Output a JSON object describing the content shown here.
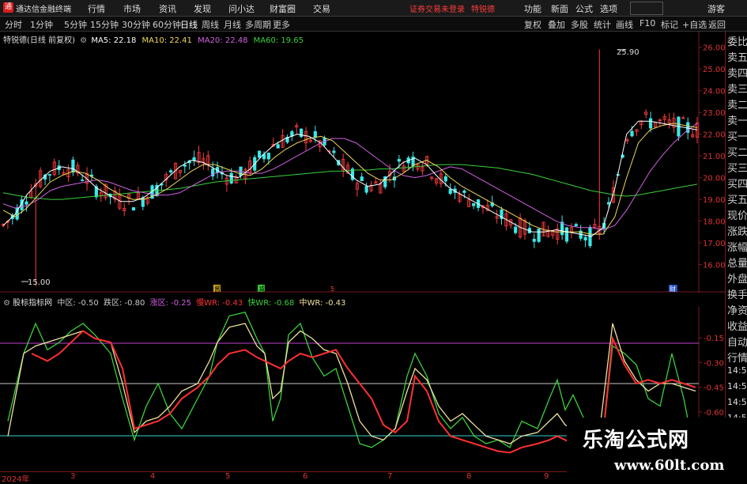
{
  "app": {
    "title": "通达信金融终端"
  },
  "menu": [
    "行情",
    "市场",
    "资讯",
    "发现",
    "问小达",
    "财富圈",
    "交易"
  ],
  "notice": {
    "text": "证券交易未登录",
    "stock": "特锐德"
  },
  "right_menu": [
    "功能",
    "新面",
    "公式",
    "选项"
  ],
  "guest": "游客",
  "periods": [
    "分时",
    "1分钟",
    "5分钟",
    "15分钟",
    "30分钟",
    "60分钟",
    "日线",
    "周线",
    "月线",
    "多周期",
    "更多"
  ],
  "active_period": "日线",
  "tools": [
    "复权",
    "叠加",
    "多股",
    "统计",
    "画线",
    "F10",
    "标记",
    "+自选",
    "返回"
  ],
  "stock": {
    "name": "特锐德(日线 前复权)"
  },
  "ma": [
    {
      "label": "MA5: 22.18",
      "color": "#ffffff"
    },
    {
      "label": "MA10: 22.41",
      "color": "#f0d85a"
    },
    {
      "label": "MA20: 22.48",
      "color": "#d060e0"
    },
    {
      "label": "MA60: 19.65",
      "color": "#3ad03a"
    }
  ],
  "price_axis": {
    "ticks": [
      "26.00",
      "25.00",
      "24.00",
      "23.00",
      "22.00",
      "21.00",
      "20.00",
      "19.00",
      "18.00",
      "17.00",
      "16.00"
    ],
    "range": [
      15.0,
      26.5
    ]
  },
  "annotations": {
    "high": "25.90",
    "low": "15.00",
    "marker_cai": "财",
    "marker_a": "酱",
    "marker_b": "减",
    "marker_c": "5"
  },
  "right_panel": [
    "委比",
    "卖五",
    "卖四",
    "卖三",
    "卖二",
    "卖一",
    "买一",
    "买二",
    "买三",
    "买四",
    "买五",
    "现价",
    "涨跌",
    "涨幅",
    "总量",
    "外盘",
    "换手",
    "净资",
    "收益",
    "自动",
    "行情",
    "14:5",
    "14:5",
    "14:5",
    "14:5",
    "14:5",
    "14:5"
  ],
  "indicator": {
    "name": "股标指标网",
    "items": [
      {
        "label": "中区: -0.50",
        "color": "#c8c8c8"
      },
      {
        "label": "跌区: -0.80",
        "color": "#c8c8c8"
      },
      {
        "label": "涨区: -0.25",
        "color": "#d060e0"
      },
      {
        "label": "慢WR: -0.43",
        "color": "#ff3030"
      },
      {
        "label": "快WR: -0.68",
        "color": "#3ad03a"
      },
      {
        "label": "中WR: -0.43",
        "color": "#f0e0a0"
      }
    ],
    "axis_ticks": [
      "-0.15",
      "-0.30",
      "-0.45",
      "-0.60"
    ],
    "range": [
      -0.9,
      0.0
    ]
  },
  "dates": [
    "2024年",
    "3",
    "4",
    "5",
    "6",
    "7",
    "8",
    "9"
  ],
  "colors": {
    "up": "#ff3c3c",
    "down": "#3ae8e8",
    "grid": "#7a1a1a",
    "ma60": "#3ad03a",
    "ma20": "#d060e0",
    "ma10": "#f0d85a",
    "ma5": "#ffffff"
  },
  "watermark": {
    "line1": "乐淘公式网",
    "line2": "www.60lt.com"
  },
  "chart_data": {
    "type": "candlestick",
    "ylim": [
      15.0,
      26.5
    ],
    "ma60": [
      19.3,
      19.2,
      19.1,
      19.05,
      19.0,
      19.0,
      19.05,
      19.1,
      19.15,
      19.2,
      19.25,
      19.3,
      19.35,
      19.4,
      19.45,
      19.5,
      19.6,
      19.7,
      19.8,
      19.85,
      19.9,
      19.95,
      20.0,
      20.05,
      20.1,
      20.15,
      20.2,
      20.25,
      20.3,
      20.3,
      20.35,
      20.35,
      20.4,
      20.4,
      20.45,
      20.5,
      20.55,
      20.6,
      20.6,
      20.6,
      20.55,
      20.5,
      20.45,
      20.35,
      20.25,
      20.15,
      20.0,
      19.85,
      19.7,
      19.55,
      19.4,
      19.3,
      19.2,
      19.15,
      19.2,
      19.3,
      19.4,
      19.5,
      19.6,
      19.7
    ],
    "ma20": [
      18.8,
      18.6,
      18.7,
      19.0,
      19.4,
      19.6,
      19.7,
      19.8,
      19.9,
      19.8,
      19.6,
      19.4,
      19.3,
      19.2,
      19.2,
      19.3,
      19.6,
      19.9,
      20.2,
      20.3,
      20.3,
      20.2,
      20.2,
      20.4,
      20.7,
      21.0,
      21.3,
      21.6,
      21.8,
      21.8,
      21.6,
      21.2,
      20.8,
      20.4,
      20.1,
      20.0,
      20.1,
      20.3,
      20.5,
      20.4,
      20.1,
      19.8,
      19.5,
      19.2,
      18.9,
      18.6,
      18.3,
      18.0,
      17.8,
      17.7,
      17.7,
      17.6,
      17.8,
      18.5,
      19.4,
      20.3,
      21.0,
      21.6,
      22.1,
      22.5
    ],
    "ma10": [
      18.5,
      18.2,
      18.6,
      19.2,
      19.8,
      20.1,
      20.3,
      20.2,
      19.9,
      19.5,
      19.2,
      19.0,
      19.0,
      19.2,
      19.5,
      19.9,
      20.3,
      20.6,
      20.6,
      20.4,
      20.2,
      20.1,
      20.4,
      20.9,
      21.3,
      21.6,
      21.8,
      21.9,
      21.7,
      21.2,
      20.7,
      20.2,
      19.9,
      19.9,
      20.2,
      20.6,
      20.8,
      20.5,
      20.0,
      19.6,
      19.3,
      19.0,
      18.7,
      18.4,
      18.1,
      17.8,
      17.6,
      17.5,
      17.5,
      17.5,
      17.4,
      17.4,
      18.2,
      20.0,
      21.6,
      22.2,
      22.4,
      22.5,
      22.4,
      22.3
    ],
    "ma5": [
      17.8,
      18.3,
      19.2,
      19.8,
      20.3,
      20.5,
      20.4,
      20.0,
      19.5,
      19.2,
      18.9,
      18.9,
      19.1,
      19.5,
      20.0,
      20.5,
      20.8,
      20.7,
      20.4,
      20.1,
      20.0,
      20.4,
      21.0,
      21.5,
      21.8,
      22.0,
      21.9,
      21.6,
      21.0,
      20.4,
      19.9,
      19.6,
      19.7,
      20.2,
      20.7,
      20.9,
      20.6,
      20.0,
      19.5,
      19.2,
      18.9,
      18.6,
      18.3,
      18.0,
      17.7,
      17.5,
      17.5,
      17.6,
      17.5,
      17.4,
      17.3,
      17.7,
      19.5,
      22.0,
      22.6,
      22.6,
      22.5,
      22.4,
      22.3,
      22.2
    ]
  }
}
